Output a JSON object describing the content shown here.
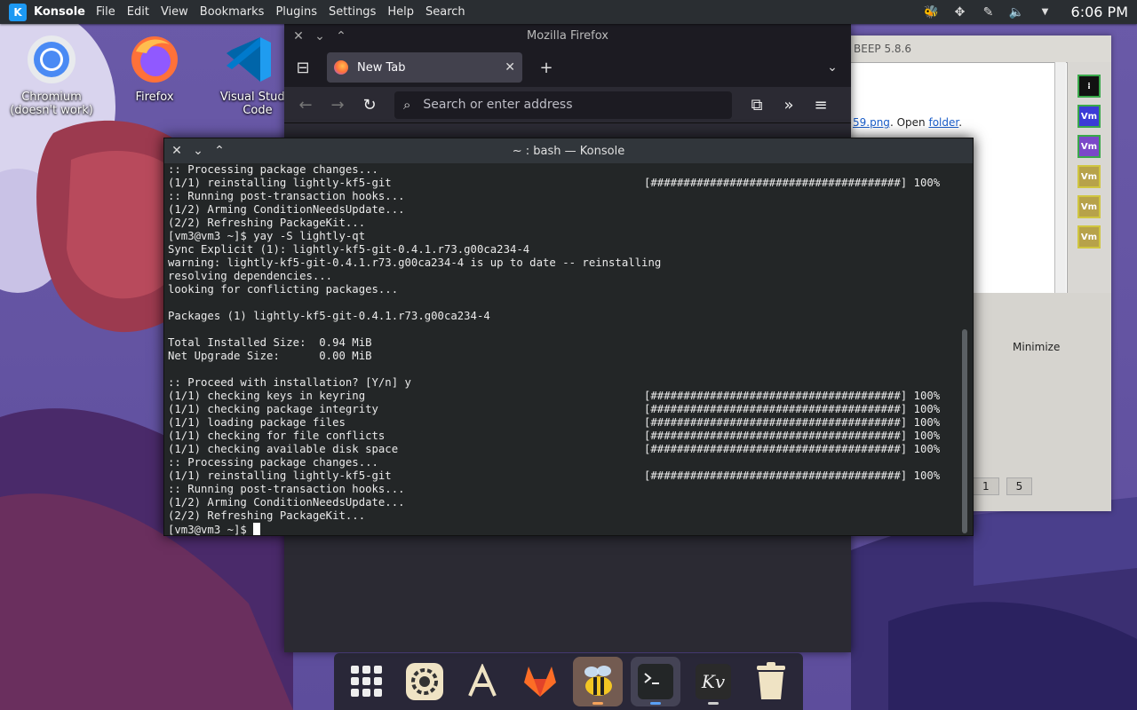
{
  "panel": {
    "app_name": "Konsole",
    "menu": [
      "File",
      "Edit",
      "View",
      "Bookmarks",
      "Plugins",
      "Settings",
      "Help",
      "Search"
    ],
    "clock": "6:06 PM"
  },
  "desktop_icons": [
    {
      "label": "Chromium (doesn't work)",
      "icon": "chromium-icon"
    },
    {
      "label": "Firefox",
      "icon": "firefox-icon"
    },
    {
      "label": "Visual Studio Code",
      "icon": "vscode-icon"
    }
  ],
  "firefox": {
    "window_title": "Mozilla Firefox",
    "tab_label": "New Tab",
    "url_placeholder": "Search or enter address"
  },
  "beep": {
    "title": "BEEP 5.8.6",
    "link_suffix": "59.png",
    "link_open": "Open",
    "link_folder": "folder",
    "vm_label": "Vm",
    "minimize_label": "Minimize",
    "status": [
      "1",
      "5"
    ]
  },
  "konsole": {
    "window_title": "~ : bash — Konsole",
    "progress_bar": "[######################################]",
    "progress_pct": "100%",
    "prompt": "[vm3@vm3 ~]$",
    "lines": [
      {
        "text": ":: Processing package changes...",
        "bar": false
      },
      {
        "text": "(1/1) reinstalling lightly-kf5-git",
        "bar": true
      },
      {
        "text": ":: Running post-transaction hooks...",
        "bar": false
      },
      {
        "text": "(1/2) Arming ConditionNeedsUpdate...",
        "bar": false
      },
      {
        "text": "(2/2) Refreshing PackageKit...",
        "bar": false
      },
      {
        "text": "[vm3@vm3 ~]$ yay -S lightly-qt",
        "bar": false
      },
      {
        "text": "Sync Explicit (1): lightly-kf5-git-0.4.1.r73.g00ca234-4",
        "bar": false
      },
      {
        "text": "warning: lightly-kf5-git-0.4.1.r73.g00ca234-4 is up to date -- reinstalling",
        "bar": false
      },
      {
        "text": "resolving dependencies...",
        "bar": false
      },
      {
        "text": "looking for conflicting packages...",
        "bar": false
      },
      {
        "text": "",
        "bar": false
      },
      {
        "text": "Packages (1) lightly-kf5-git-0.4.1.r73.g00ca234-4",
        "bar": false
      },
      {
        "text": "",
        "bar": false
      },
      {
        "text": "Total Installed Size:  0.94 MiB",
        "bar": false
      },
      {
        "text": "Net Upgrade Size:      0.00 MiB",
        "bar": false
      },
      {
        "text": "",
        "bar": false
      },
      {
        "text": ":: Proceed with installation? [Y/n] y",
        "bar": false
      },
      {
        "text": "(1/1) checking keys in keyring",
        "bar": true
      },
      {
        "text": "(1/1) checking package integrity",
        "bar": true
      },
      {
        "text": "(1/1) loading package files",
        "bar": true
      },
      {
        "text": "(1/1) checking for file conflicts",
        "bar": true
      },
      {
        "text": "(1/1) checking available disk space",
        "bar": true
      },
      {
        "text": ":: Processing package changes...",
        "bar": false
      },
      {
        "text": "(1/1) reinstalling lightly-kf5-git",
        "bar": true
      },
      {
        "text": ":: Running post-transaction hooks...",
        "bar": false
      },
      {
        "text": "(1/2) Arming ConditionNeedsUpdate...",
        "bar": false
      },
      {
        "text": "(2/2) Refreshing PackageKit...",
        "bar": false
      }
    ]
  },
  "dock": [
    {
      "name": "app-grid-icon",
      "state": ""
    },
    {
      "name": "settings-icon",
      "state": ""
    },
    {
      "name": "appstore-icon",
      "state": ""
    },
    {
      "name": "gitlab-fox-icon",
      "state": ""
    },
    {
      "name": "beep-bee-icon",
      "state": "active"
    },
    {
      "name": "terminal-icon",
      "state": "focused"
    },
    {
      "name": "kvantum-icon",
      "state": "running"
    },
    {
      "name": "trash-icon",
      "state": ""
    }
  ],
  "colors": {
    "terminal_bg": "#232627",
    "panel_bg": "#2a2e32",
    "accent": "#1d99f3"
  }
}
